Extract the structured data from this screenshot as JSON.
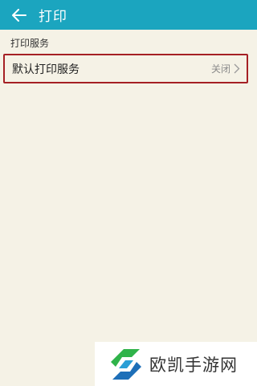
{
  "app_bar": {
    "title": "打印",
    "back_icon": "arrow-left-icon",
    "background_color": "#1ba5bf"
  },
  "section": {
    "header": "打印服务"
  },
  "list": {
    "items": [
      {
        "label": "默认打印服务",
        "value": "关闭",
        "icon": "chevron-right-icon",
        "highlight_color": "#a52024"
      }
    ]
  },
  "watermark": {
    "text": "欧凯手游网",
    "logo": "ok-logo"
  }
}
